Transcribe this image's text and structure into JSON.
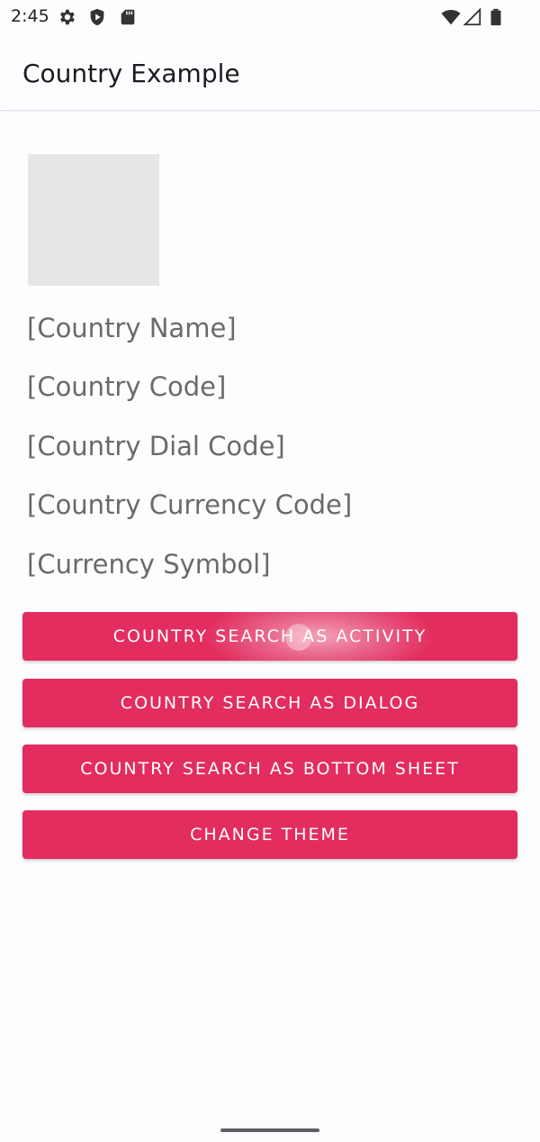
{
  "status_bar": {
    "time": "2:45",
    "left_icons": [
      "gear-icon",
      "shield-play-icon",
      "sd-card-icon"
    ],
    "right_icons": [
      "wifi-icon",
      "cell-signal-icon",
      "battery-icon"
    ]
  },
  "app_bar": {
    "title": "Country Example"
  },
  "country_info": {
    "name": "[Country Name]",
    "code": "[Country Code]",
    "dial_code": "[Country Dial Code]",
    "currency_code": "[Country Currency Code]",
    "currency_symbol": "[Currency Symbol]"
  },
  "buttons": {
    "search_activity": "COUNTRY SEARCH AS ACTIVITY",
    "search_dialog": "COUNTRY SEARCH AS DIALOG",
    "search_bottom_sheet": "COUNTRY SEARCH AS BOTTOM SHEET",
    "change_theme": "CHANGE THEME"
  },
  "colors": {
    "accent": "#e22d5e",
    "background": "#fdfcff",
    "placeholder": "#e6e6e9",
    "secondary_text": "#6a6a6a"
  }
}
